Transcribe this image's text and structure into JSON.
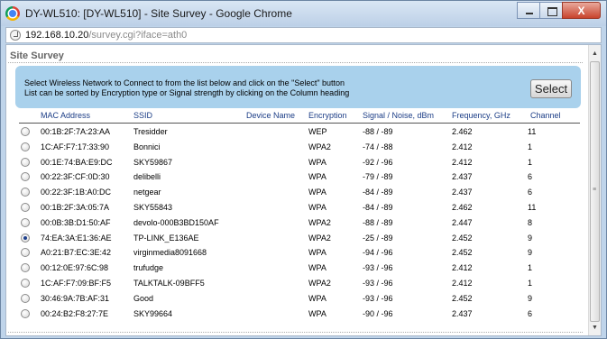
{
  "window": {
    "title": "DY-WL510: [DY-WL510] - Site Survey - Google Chrome",
    "close_glyph": "X"
  },
  "address": {
    "host": "192.168.10.20",
    "path": "/survey.cgi?iface=ath0"
  },
  "page": {
    "heading": "Site Survey",
    "instruction_line1": "Select Wireless Network to Connect to from the list below and click on the \"Select\" button",
    "instruction_line2": "List can be sorted by Encryption type or Signal strength by clicking on the Column heading",
    "select_label": "Select"
  },
  "table": {
    "columns": [
      "MAC Address",
      "SSID",
      "Device Name",
      "Encryption",
      "Signal / Noise, dBm",
      "Frequency, GHz",
      "Channel"
    ],
    "rows": [
      {
        "mac": "00:1B:2F:7A:23:AA",
        "ssid": "Tresidder",
        "device": "",
        "enc": "WEP",
        "signal": "-88 / -89",
        "freq": "2.462",
        "channel": "11",
        "selected": false
      },
      {
        "mac": "1C:AF:F7:17:33:90",
        "ssid": "Bonnici",
        "device": "",
        "enc": "WPA2",
        "signal": "-74 / -88",
        "freq": "2.412",
        "channel": "1",
        "selected": false
      },
      {
        "mac": "00:1E:74:BA:E9:DC",
        "ssid": "SKY59867",
        "device": "",
        "enc": "WPA",
        "signal": "-92 / -96",
        "freq": "2.412",
        "channel": "1",
        "selected": false
      },
      {
        "mac": "00:22:3F:CF:0D:30",
        "ssid": "delibelli",
        "device": "",
        "enc": "WPA",
        "signal": "-79 / -89",
        "freq": "2.437",
        "channel": "6",
        "selected": false
      },
      {
        "mac": "00:22:3F:1B:A0:DC",
        "ssid": "netgear",
        "device": "",
        "enc": "WPA",
        "signal": "-84 / -89",
        "freq": "2.437",
        "channel": "6",
        "selected": false
      },
      {
        "mac": "00:1B:2F:3A:05:7A",
        "ssid": "SKY55843",
        "device": "",
        "enc": "WPA",
        "signal": "-84 / -89",
        "freq": "2.462",
        "channel": "11",
        "selected": false
      },
      {
        "mac": "00:0B:3B:D1:50:AF",
        "ssid": "devolo-000B3BD150AF",
        "device": "",
        "enc": "WPA2",
        "signal": "-88 / -89",
        "freq": "2.447",
        "channel": "8",
        "selected": false
      },
      {
        "mac": "74:EA:3A:E1:36:AE",
        "ssid": "TP-LINK_E136AE",
        "device": "",
        "enc": "WPA2",
        "signal": "-25 / -89",
        "freq": "2.452",
        "channel": "9",
        "selected": true
      },
      {
        "mac": "A0:21:B7:EC:3E:42",
        "ssid": "virginmedia8091668",
        "device": "",
        "enc": "WPA",
        "signal": "-94 / -96",
        "freq": "2.452",
        "channel": "9",
        "selected": false
      },
      {
        "mac": "00:12:0E:97:6C:98",
        "ssid": "trufudge",
        "device": "",
        "enc": "WPA",
        "signal": "-93 / -96",
        "freq": "2.412",
        "channel": "1",
        "selected": false
      },
      {
        "mac": "1C:AF:F7:09:BF:F5",
        "ssid": "TALKTALK-09BFF5",
        "device": "",
        "enc": "WPA2",
        "signal": "-93 / -96",
        "freq": "2.412",
        "channel": "1",
        "selected": false
      },
      {
        "mac": "30:46:9A:7B:AF:31",
        "ssid": "Good",
        "device": "",
        "enc": "WPA",
        "signal": "-93 / -96",
        "freq": "2.452",
        "channel": "9",
        "selected": false
      },
      {
        "mac": "00:24:B2:F8:27:7E",
        "ssid": "SKY99664",
        "device": "",
        "enc": "WPA",
        "signal": "-90 / -96",
        "freq": "2.437",
        "channel": "6",
        "selected": false
      }
    ]
  },
  "colors": {
    "info_box": "#a9d1ec",
    "header_text": "#1b3d86",
    "title_bar": "#bcd0e7"
  },
  "icons": {
    "browser": "chrome-icon",
    "page": "page-icon",
    "close": "close-icon",
    "minimize": "minimize-icon",
    "maximize": "maximize-icon"
  }
}
